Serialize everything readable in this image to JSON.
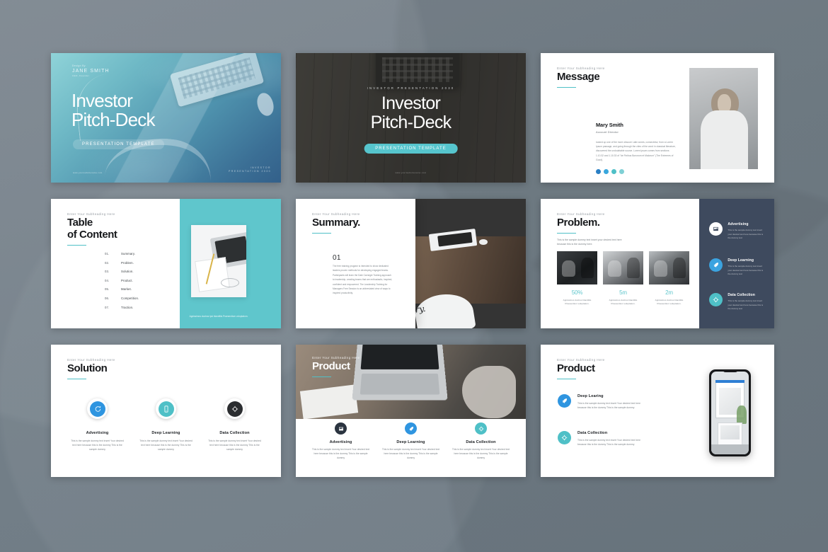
{
  "background": {
    "color": "#78838c"
  },
  "accent": {
    "teal": "#5fc6cc",
    "blue": "#3ba3e0",
    "dark_navy": "#3e4a5e",
    "charcoal": "#343434"
  },
  "common": {
    "subheading": "Enter Your Subheading Here",
    "feature_desc": "This is the sample dummy text insert Your desired text here because this is the dummy This is the sample dummy",
    "feature_desc_dark": "This is the sample dummy text insert your desired text here because this is the dummy text"
  },
  "slides": [
    {
      "id": "cover-gradient",
      "design_by_label": "Design By",
      "author": "JANE SMITH",
      "author_sub": "CEO, Founder",
      "title_line1": "Investor",
      "title_line2": "Pitch-Deck",
      "pill": "PRESENTATION TEMPLATE",
      "url": "www.yourwebsitename.com",
      "corner_line1": "INVESTOR",
      "corner_line2": "PRESENTATION 2030"
    },
    {
      "id": "cover-dark",
      "kicker": "INVESTOR PRESENTATION 2030",
      "title_line1": "Investor",
      "title_line2": "Pitch-Deck",
      "pill": "PRESENTATION TEMPLATE",
      "url": "www.yourwebsitename.com"
    },
    {
      "id": "message",
      "subheading": "Enter Your Subheading Here",
      "title": "Message",
      "person_name": "Mary Smith",
      "person_role": "Account Director",
      "person_bio": "looked up one of the more obscure Latin words, consectetur, from a Lorem Ipsum passage, and going through the cites of the word in classical literature, discovered the undoubtable source. Lorem Ipsum comes from sections 1.10.32 and 1.10.33 of \"de Finibus Bonorum et Malorum\" (The Extremes of Good).",
      "social": [
        "facebook-icon",
        "twitter-icon",
        "instagram-icon",
        "linkedin-icon"
      ],
      "social_colors": [
        "#2a7fc4",
        "#39a7dd",
        "#4fc0c7",
        "#7fd0d5"
      ]
    },
    {
      "id": "table-of-content",
      "subheading": "Enter Your Subheading Here",
      "title_line1": "Table",
      "title_line2": "of Content",
      "items": [
        {
          "num": "01.",
          "label": "Summary."
        },
        {
          "num": "02.",
          "label": "Problem."
        },
        {
          "num": "03.",
          "label": "Solution."
        },
        {
          "num": "04.",
          "label": "Product."
        },
        {
          "num": "05.",
          "label": "Market."
        },
        {
          "num": "06.",
          "label": "Competition."
        },
        {
          "num": "07.",
          "label": "Traction."
        }
      ],
      "caption": "Agnissimos ductrus ipsi blanditiis Praesentium voluptatum."
    },
    {
      "id": "summary",
      "subheading": "Enter Your Subheading Here",
      "title": "Summary.",
      "number": "01",
      "paragraph": "The free training program is intended to show dedicated leaders proven methods for developing engaged teams. Participants will learn the Dale Carnegie Training approach to leadership, creating teams that are enthusiastic, inspired, confident and empowered. The Leadership Training for Managers Free Session is an abbreviated view of ways to inspired productivity.",
      "signature": "Summary."
    },
    {
      "id": "problem",
      "subheading": "Enter Your Subheading Here",
      "title": "Problem.",
      "intro": "This is the sample dummy text insert your desired text here because this is the dummy here.",
      "stats": [
        {
          "value": "50%",
          "label": "Agnissimos ductrus blanditiis Praesentium voluptatum."
        },
        {
          "value": "5m",
          "label": "Agnissimos ductrus blanditiis Praesentium voluptatum."
        },
        {
          "value": "2m",
          "label": "Agnissimos ductrus blanditiis Praesentium voluptatum."
        }
      ],
      "features": [
        {
          "icon": "image-icon",
          "title": "Advertising",
          "desc": "This is the sample dummy text insert your desired text here because this is the dummy text",
          "bg": "#ffffff",
          "fg": "#3e4a5e"
        },
        {
          "icon": "rocket-icon",
          "title": "Deep Learning",
          "desc": "This is the sample dummy text insert your desired text here because this is the dummy text",
          "bg": "#3ba3e0",
          "fg": "#ffffff"
        },
        {
          "icon": "target-icon",
          "title": "Data Collection",
          "desc": "This is the sample dummy text insert your desired text here because this is the dummy text",
          "bg": "#4fc0c7",
          "fg": "#ffffff"
        }
      ]
    },
    {
      "id": "solution",
      "subheading": "Enter Your Subheading Here",
      "title": "Solution",
      "features": [
        {
          "icon": "chat-icon",
          "title": "Advertising",
          "desc": "This is the sample dummy text insert Your desired text here because this is the dummy This is the sample dummy",
          "bg": "#2f95e0"
        },
        {
          "icon": "mobile-icon",
          "title": "Deep Learning",
          "desc": "This is the sample dummy text insert Your desired text here because this is the dummy This is the sample dummy",
          "bg": "#4fc0c7"
        },
        {
          "icon": "target-icon",
          "title": "Data Collection",
          "desc": "This is the sample dummy text insert Your desired text here because this is the dummy This is the sample dummy",
          "bg": "#2b2d30"
        }
      ]
    },
    {
      "id": "product-hero",
      "subheading": "Enter Your Subheading Here",
      "title": "Product",
      "features": [
        {
          "icon": "image-icon",
          "title": "Advertising",
          "desc": "This is the sample dummy text insert Your desired text here because this is the dummy This is the sample dummy",
          "bg": "#2b3440"
        },
        {
          "icon": "rocket-icon",
          "title": "Deep Learning",
          "desc": "This is the sample dummy text insert Your desired text here because this is the dummy This is the sample dummy",
          "bg": "#2f95e0"
        },
        {
          "icon": "target-icon",
          "title": "Data Collection",
          "desc": "This is the sample dummy text insert Your desired text here because this is the dummy This is the sample dummy",
          "bg": "#4fc0c7"
        }
      ]
    },
    {
      "id": "product-phone",
      "subheading": "Enter Your Subheading Here",
      "title": "Product",
      "features": [
        {
          "icon": "rocket-icon",
          "title": "Deep Learing",
          "desc": "This is the sample dummy text insert Your desired text here because this is the dummy This is the sample dummy",
          "bg": "#2f95e0"
        },
        {
          "icon": "target-icon",
          "title": "Data Collection",
          "desc": "This is the sample dummy text insert Your desired text here because this is the dummy This is the sample dummy",
          "bg": "#4fc0c7"
        }
      ]
    }
  ]
}
